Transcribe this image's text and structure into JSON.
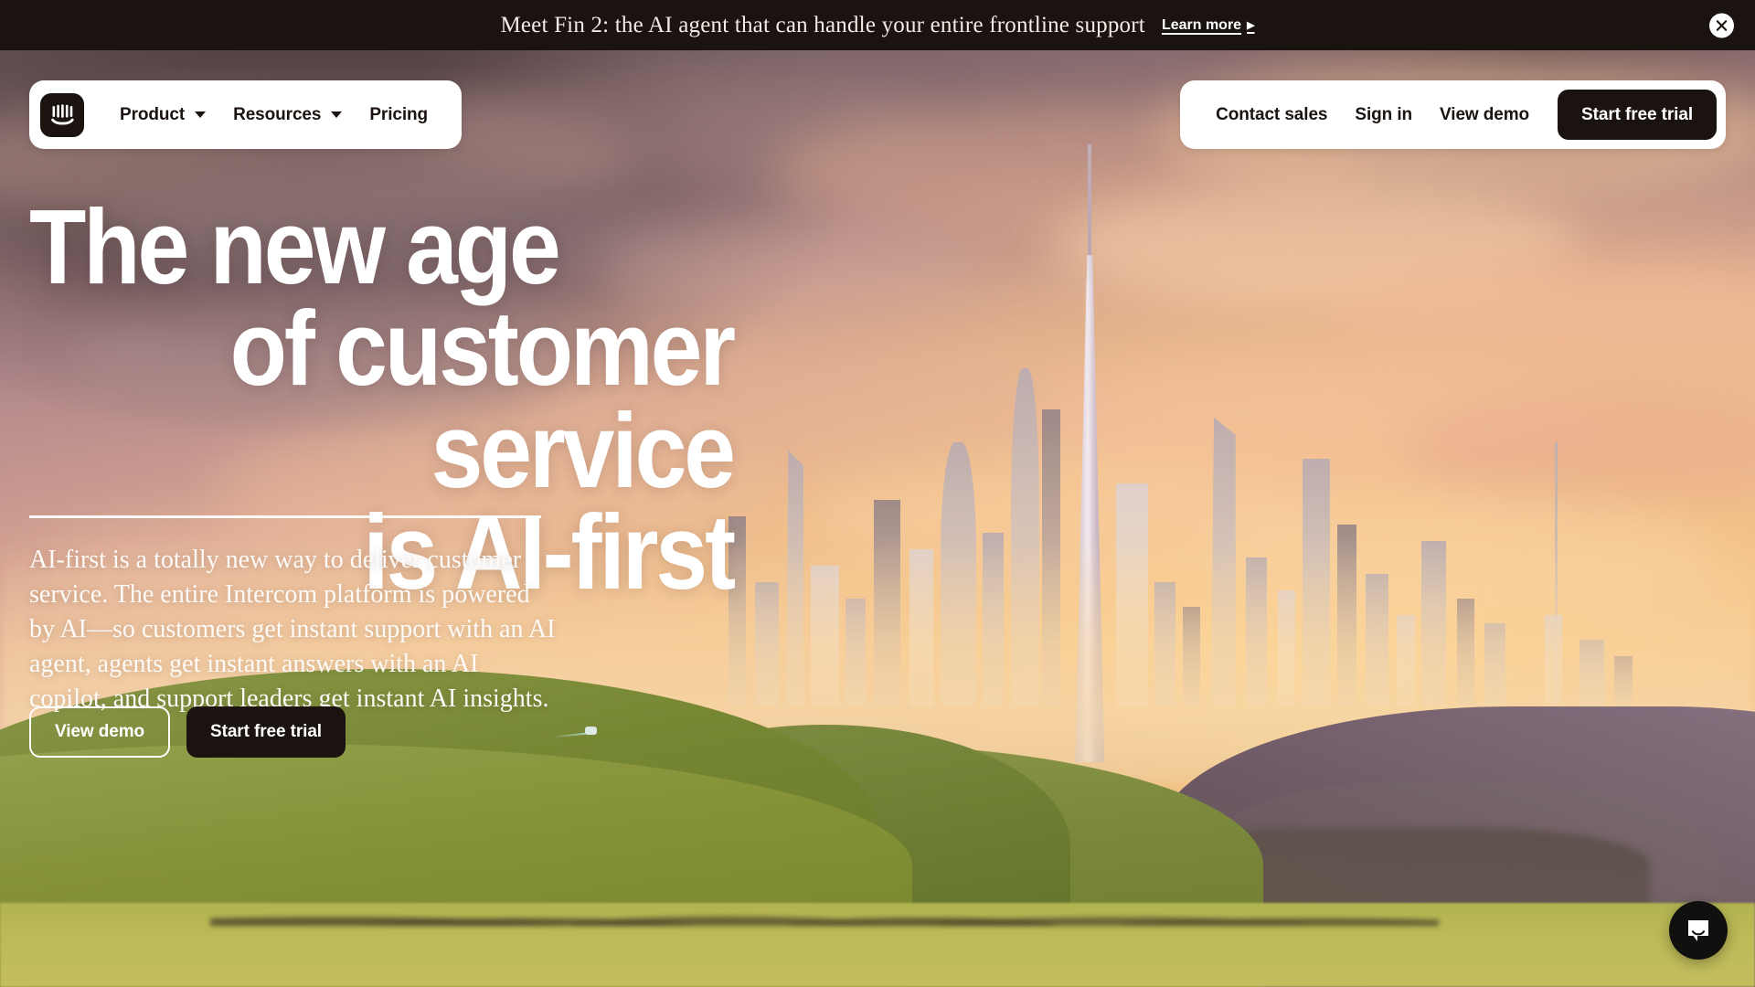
{
  "banner": {
    "message": "Meet Fin 2: the AI agent that can handle your entire frontline support",
    "link_label": "Learn more",
    "link_arrow": "▶",
    "close_icon": "close-icon"
  },
  "nav": {
    "logo": "intercom-logo",
    "left_items": [
      {
        "label": "Product",
        "has_caret": true
      },
      {
        "label": "Resources",
        "has_caret": true
      },
      {
        "label": "Pricing",
        "has_caret": false
      }
    ],
    "right_links": [
      {
        "label": "Contact sales"
      },
      {
        "label": "Sign in"
      },
      {
        "label": "View demo"
      }
    ],
    "cta_label": "Start free trial"
  },
  "hero": {
    "headline_line1": "The new age",
    "headline_line2": "of customer service",
    "headline_line3": "is AI-first",
    "lede": "AI-first is a totally new way to deliver customer service. The entire Intercom platform is powered by AI—so customers get instant support with an AI agent, agents get instant answers with an AI copilot, and support leaders get instant AI insights.",
    "cta_secondary": "View demo",
    "cta_primary": "Start free trial"
  },
  "widget": {
    "launcher_icon": "chat-bubble-icon"
  },
  "colors": {
    "ink": "#1A1310",
    "surface": "#FFFFFF",
    "banner_bg": "#1A1310",
    "text_on_dark": "#FFFFFF",
    "sky_warm": "#F4C389",
    "sky_dusk": "#6D5A5E",
    "hill_green": "#86913F"
  }
}
